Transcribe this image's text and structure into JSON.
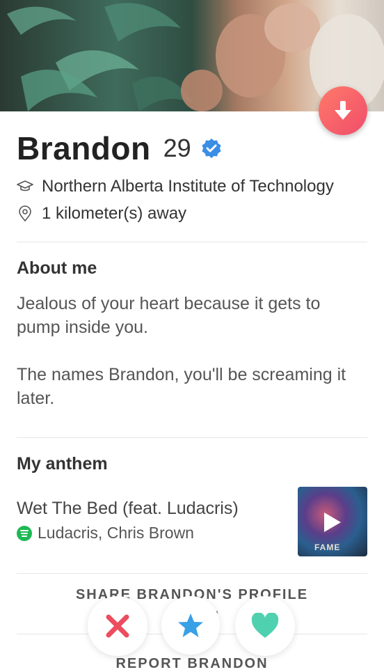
{
  "profile": {
    "name": "Brandon",
    "age": "29",
    "school": "Northern Alberta Institute of Technology",
    "distance": "1 kilometer(s) away"
  },
  "about": {
    "title": "About me",
    "lines": [
      "Jealous of your heart because it gets to pump inside you.",
      "The names Brandon, you'll be screaming it later."
    ]
  },
  "anthem": {
    "title": "My anthem",
    "song": "Wet The Bed (feat. Ludacris)",
    "artist": "Ludacris, Chris Brown",
    "album_text": "FAME"
  },
  "actions": {
    "share_profile": "SHARE BRANDON'S PROFILE",
    "share_partial": "'AT         ND '",
    "report": "REPORT BRANDON"
  },
  "colors": {
    "accent": "#f04d6a",
    "verified": "#3a8ee6",
    "nope": "#ec4d5f",
    "super_like": "#3aa0e6",
    "like": "#4fd1b0",
    "spotify": "#1db954"
  },
  "icons": {
    "down": "arrow-down-icon",
    "verified": "verified-badge-icon",
    "school": "graduation-cap-icon",
    "location": "location-pin-icon",
    "nope": "x-icon",
    "super_like": "star-icon",
    "like": "heart-icon"
  }
}
